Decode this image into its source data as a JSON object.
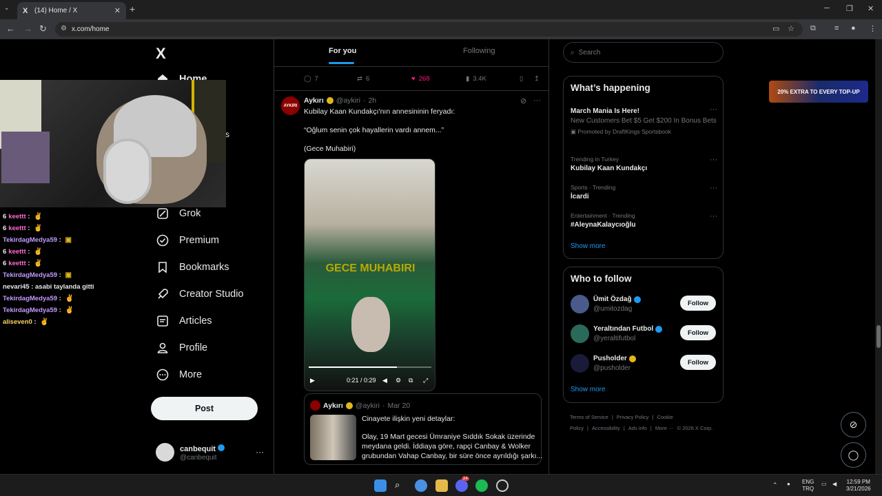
{
  "browser": {
    "tab_title": "(14) Home / X",
    "tab_favicon": "X",
    "url": "x.com/home"
  },
  "nav": {
    "logo": "X",
    "home": "Home",
    "items": [
      {
        "label": "Grok",
        "icon": "grok-icon"
      },
      {
        "label": "Premium",
        "icon": "premium-icon"
      },
      {
        "label": "Bookmarks",
        "icon": "bookmark-icon"
      },
      {
        "label": "Creator Studio",
        "icon": "rocket-icon"
      },
      {
        "label": "Articles",
        "icon": "articles-icon"
      },
      {
        "label": "Profile",
        "icon": "person-icon"
      },
      {
        "label": "More",
        "icon": "more-circle-icon"
      }
    ],
    "partial_label": "s",
    "post_label": "Post",
    "account": {
      "name": "canbequit",
      "handle": "@canbequit",
      "more": "···"
    }
  },
  "chat": [
    {
      "user": "keettt",
      "color": "#ff6ad5",
      "prefix": "6",
      "text": "",
      "emote": "✌"
    },
    {
      "user": "keettt",
      "color": "#ff6ad5",
      "prefix": "6",
      "text": "",
      "emote": "✌"
    },
    {
      "user": "TekirdagMedya59",
      "color": "#c39bff",
      "prefix": "",
      "text": "",
      "emote": "▣"
    },
    {
      "user": "keettt",
      "color": "#ff6ad5",
      "prefix": "6",
      "text": "",
      "emote": "✌"
    },
    {
      "user": "keettt",
      "color": "#ff6ad5",
      "prefix": "6",
      "text": "",
      "emote": "✌"
    },
    {
      "user": "TekirdagMedya59",
      "color": "#c39bff",
      "prefix": "",
      "text": "",
      "emote": "▣"
    },
    {
      "user": "nevari45",
      "color": "#e7e9ea",
      "prefix": "",
      "text": "asabi taylanda gitti",
      "emote": ""
    },
    {
      "user": "TekirdagMedya59",
      "color": "#c39bff",
      "prefix": "",
      "text": "",
      "emote": "✌"
    },
    {
      "user": "TekirdagMedya59",
      "color": "#c39bff",
      "prefix": "",
      "text": "",
      "emote": "✌"
    },
    {
      "user": "aliseven0",
      "color": "#ffd36a",
      "prefix": "",
      "text": "",
      "emote": "✌"
    }
  ],
  "timeline": {
    "tab_for_you": "For you",
    "tab_following": "Following",
    "prev_actions": {
      "replies": "7",
      "reposts": "6",
      "likes": "268",
      "views": "3.4K"
    },
    "tweet": {
      "avatar_text": "AYKIRI",
      "name": "Aykırı",
      "handle": "@aykiri",
      "time": "2h",
      "lines": [
        "Kubilay Kaan Kundakçı'nın annesininin feryadı:",
        "“Oğlum senin çok hayallerin vardı annem...”",
        "(Gece Muhabiri)"
      ],
      "video": {
        "overlay_text": "GECE MUHABIRI",
        "time": "0:21 / 0:29",
        "progress": 0.72
      },
      "quote": {
        "name": "Aykırı",
        "handle": "@aykiri",
        "date": "Mar 20",
        "title": "Cinayete ilişkin yeni detaylar:",
        "lines": [
          "Olay, 19 Mart gecesi Ümraniye Sıddık Sokak üzerinde",
          "meydana geldi. İddiaya göre, rapçi Canbay & Wolker",
          "grubundan Vahap Canbay, bir süre önce ayrıldığı şarkı..."
        ]
      }
    }
  },
  "sidebar": {
    "search_placeholder": "Search",
    "happening": {
      "title": "What’s happening",
      "items": [
        {
          "context": "",
          "title": "March Mania Is Here!",
          "desc": "New Customers Bet $5 Get $200 In Bonus Bets",
          "promo": "Promoted by DraftKings Sportsbook"
        },
        {
          "context": "Trending in Turkey",
          "title": "Kubilay Kaan Kundakçı",
          "desc": "",
          "promo": ""
        },
        {
          "context": "Sports · Trending",
          "title": "İcardi",
          "desc": "",
          "promo": ""
        },
        {
          "context": "Entertainment · Trending",
          "title": "#AleynaKalaycıoğlu",
          "desc": "",
          "promo": ""
        }
      ],
      "show_more": "Show more"
    },
    "who_to_follow": {
      "title": "Who to follow",
      "users": [
        {
          "name": "Ümit Özdağ",
          "handle": "@umitozdag",
          "badge": "blue",
          "avatar": "#4a5a8a",
          "follow": "Follow"
        },
        {
          "name": "Yeraltından Futbol",
          "handle": "@yeraltifutbol",
          "badge": "blue",
          "avatar": "#2a6a5a",
          "follow": "Follow"
        },
        {
          "name": "Pusholder",
          "handle": "@pusholder",
          "badge": "gold",
          "avatar": "#1a1a3a",
          "follow": "Follow"
        }
      ],
      "show_more": "Show more"
    },
    "footer": [
      "Terms of Service",
      "|",
      "Privacy Policy",
      "|",
      "Cookie Policy",
      "|",
      "Accessibility",
      "|",
      "Ads info",
      "|",
      "More ···",
      "© 2026 X Corp."
    ],
    "ad_text": "20% EXTRA TO EVERY TOP-UP"
  },
  "taskbar": {
    "lang": "ENG",
    "region": "TRQ",
    "time": "12:59 PM",
    "date": "3/21/2026",
    "discord_badge": "24"
  },
  "colors": {
    "accent": "#1d9bf0",
    "like": "#f91880",
    "gold_badge": "#e2b719"
  }
}
